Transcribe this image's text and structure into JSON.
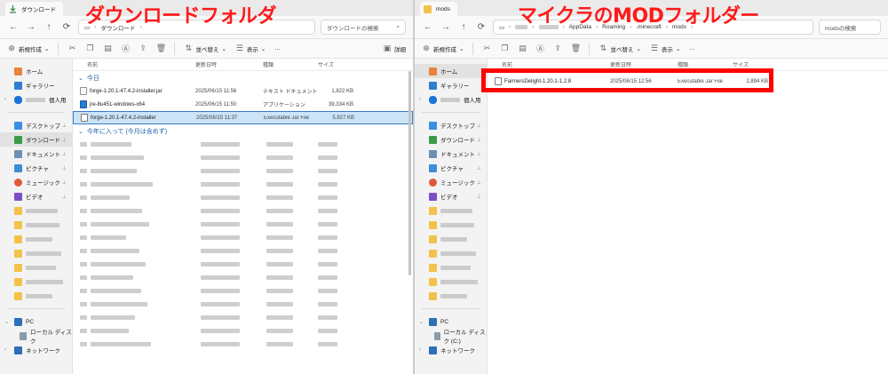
{
  "annotations": {
    "left_title": "ダウンロードフォルダ",
    "right_title": "マイクラのMODフォルダー"
  },
  "left": {
    "tab_title": "ダウンロード",
    "breadcrumb": [
      "ダウンロード"
    ],
    "search_placeholder": "ダウンロードの検索",
    "toolbar": {
      "new": "新規作成",
      "sort": "並べ替え",
      "view": "表示",
      "more": "…",
      "details": "詳細"
    },
    "nav": {
      "home": "ホーム",
      "gallery": "ギャラリー",
      "personal": "個人用",
      "desktop": "デスクトップ",
      "downloads": "ダウンロード",
      "documents": "ドキュメント",
      "pictures": "ピクチャ",
      "music": "ミュージック",
      "videos": "ビデオ",
      "pc": "PC",
      "local_disk": "ローカル ディスク",
      "network": "ネットワーク"
    },
    "columns": {
      "name": "名前",
      "date": "更新日時",
      "type": "種類",
      "size": "サイズ"
    },
    "groups": {
      "today": "今日",
      "this_year": "今年に入って (今月は含めず)"
    },
    "files": [
      {
        "name": "forge-1.20.1-47.4.2-installer.jar",
        "date": "2025/06/15 11:56",
        "type": "テキスト ドキュメント",
        "size": "1,822 KB",
        "icon": "text-file-icon"
      },
      {
        "name": "jre-8u451-windows-x64",
        "date": "2025/06/15 11:50",
        "type": "アプリケーション",
        "size": "39,334 KB",
        "icon": "application-icon"
      },
      {
        "name": "forge-1.20.1-47.4.2-installer",
        "date": "2025/06/15 11:37",
        "type": "Executable Jar File",
        "size": "5,927 KB",
        "icon": "jar-file-icon"
      }
    ]
  },
  "right": {
    "tab_title": "mods",
    "breadcrumb": [
      "AppData",
      "Roaming",
      ".minecraft",
      "mods"
    ],
    "search_placeholder": "modsの検索",
    "toolbar": {
      "new": "新規作成",
      "sort": "並べ替え",
      "view": "表示",
      "more": "…"
    },
    "nav": {
      "home": "ホーム",
      "gallery": "ギャラリー",
      "personal": "個人用",
      "desktop": "デスクトップ",
      "downloads": "ダウンロード",
      "documents": "ドキュメント",
      "pictures": "ピクチャ",
      "music": "ミュージック",
      "videos": "ビデオ",
      "pc": "PC",
      "local_disk": "ローカル ディスク (C:)",
      "network": "ネットワーク"
    },
    "columns": {
      "name": "名前",
      "date": "更新日時",
      "type": "種類",
      "size": "サイズ"
    },
    "files": [
      {
        "name": "FarmersDelight-1.20.1-1.2.8",
        "date": "2025/06/15 12:56",
        "type": "Executable Jar File",
        "size": "2,894 KB",
        "icon": "jar-file-icon"
      }
    ]
  },
  "colors": {
    "annotation": "#ff1a1a",
    "highlight": "#ff0000",
    "selection": "#cce4f7",
    "group_text": "#1f5fa8"
  }
}
